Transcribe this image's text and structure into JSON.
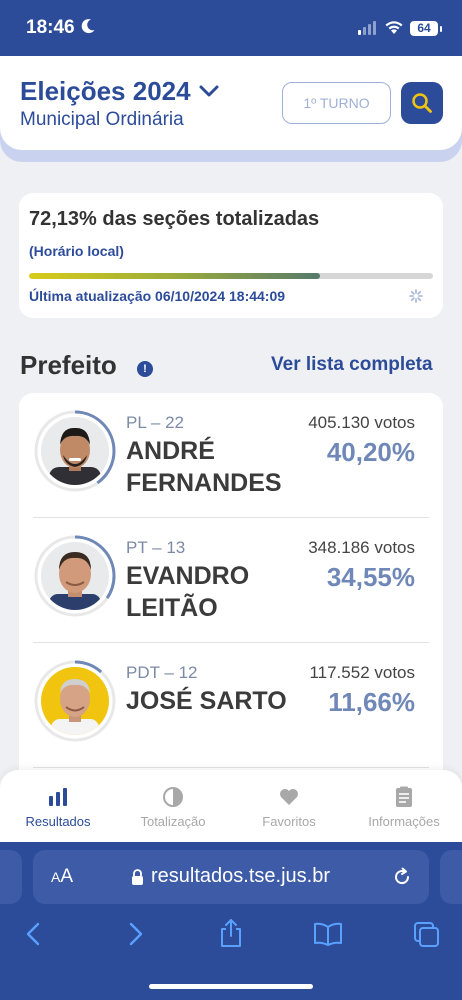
{
  "status_bar": {
    "time": "18:46",
    "battery": "64"
  },
  "header": {
    "title": "Eleições 2024",
    "subtitle": "Municipal Ordinária",
    "turno_label": "1º TURNO"
  },
  "progress": {
    "title": "72,13% das seções totalizadas",
    "local_time_label": "(Horário local)",
    "fraction": 0.7213,
    "last_update": "Última atualização 06/10/2024 18:44:09"
  },
  "section": {
    "title": "Prefeito",
    "info_glyph": "!",
    "link": "Ver lista completa"
  },
  "candidates": [
    {
      "party": "PL – 22",
      "name_line1": "ANDRÉ",
      "name_line2": "FERNANDES",
      "votes": "405.130 votos",
      "percent": "40,20%",
      "fraction": 0.402,
      "avatar_bg": "#e9eaec"
    },
    {
      "party": "PT – 13",
      "name_line1": "EVANDRO",
      "name_line2": "LEITÃO",
      "votes": "348.186 votos",
      "percent": "34,55%",
      "fraction": 0.3455,
      "avatar_bg": "#e9eaec"
    },
    {
      "party": "PDT – 12",
      "name_line1": "JOSÉ SARTO",
      "name_line2": "",
      "votes": "117.552 votos",
      "percent": "11,66%",
      "fraction": 0.1166,
      "avatar_bg": "#f1c40f"
    }
  ],
  "bottom_nav": [
    {
      "label": "Resultados",
      "icon": "bar-chart-icon",
      "active": true
    },
    {
      "label": "Totalização",
      "icon": "pie-chart-icon",
      "active": false
    },
    {
      "label": "Favoritos",
      "icon": "heart-icon",
      "active": false
    },
    {
      "label": "Informações",
      "icon": "clipboard-icon",
      "active": false
    }
  ],
  "browser": {
    "text_size_label_small": "A",
    "text_size_label_large": "A",
    "url": "resultados.tse.jus.br"
  },
  "colors": {
    "brand_blue": "#2c4c9a",
    "accent_yellow": "#f1c40f",
    "percent_blue": "#7088b8"
  }
}
